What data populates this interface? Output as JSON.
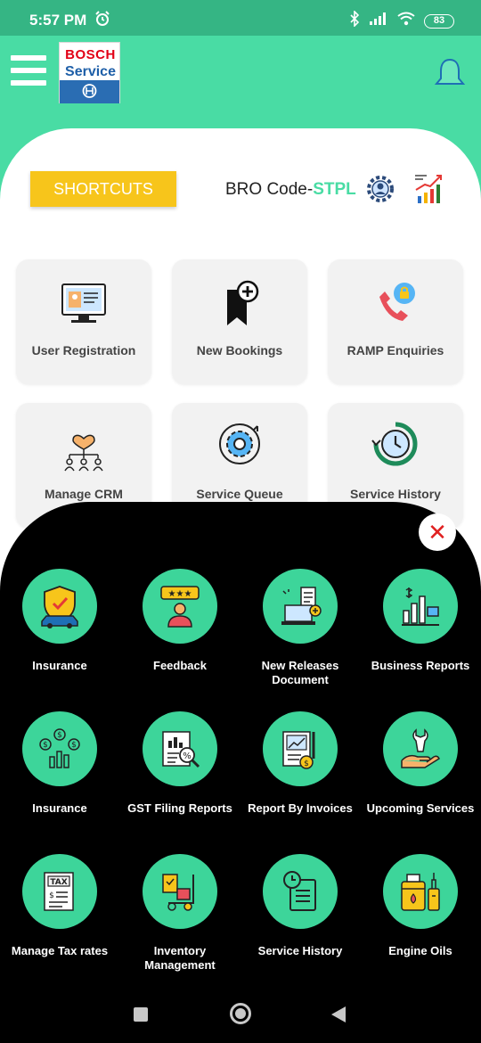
{
  "status_bar": {
    "time": "5:57 PM",
    "battery": "83",
    "icons": [
      "alarm-icon",
      "bluetooth-icon",
      "signal-icon",
      "wifi-icon",
      "battery-icon"
    ]
  },
  "header": {
    "logo_brand": "BOSCH",
    "logo_sub": "Service",
    "menu_icon": "hamburger-icon",
    "bell_icon": "bell-icon"
  },
  "shortcuts": {
    "button_label": "SHORTCUTS",
    "bro_code_label": "BRO Code-",
    "bro_code_value": "STPL"
  },
  "tiles": [
    {
      "label": "User Registration",
      "icon": "user-registration-icon"
    },
    {
      "label": "New Bookings",
      "icon": "bookmark-add-icon"
    },
    {
      "label": "RAMP Enquiries",
      "icon": "phone-enquiry-icon"
    },
    {
      "label": "Manage CRM",
      "icon": "crm-icon"
    },
    {
      "label": "Service Queue",
      "icon": "gear-icon"
    },
    {
      "label": "Service History",
      "icon": "history-clock-icon"
    }
  ],
  "menu": {
    "items": [
      {
        "label": "Insurance",
        "icon": "shield-car-icon"
      },
      {
        "label": "Feedback",
        "icon": "rating-feedback-icon"
      },
      {
        "label": "New Releases Document",
        "icon": "document-release-icon"
      },
      {
        "label": "Business Reports",
        "icon": "business-chart-icon"
      },
      {
        "label": "Insurance",
        "icon": "money-chart-icon"
      },
      {
        "label": "GST Filing Reports",
        "icon": "gst-report-icon"
      },
      {
        "label": "Report By Invoices",
        "icon": "invoice-report-icon"
      },
      {
        "label": "Upcoming Services",
        "icon": "wrench-hand-icon"
      },
      {
        "label": "Manage Tax rates",
        "icon": "tax-document-icon"
      },
      {
        "label": "Inventory Management",
        "icon": "inventory-trolley-icon"
      },
      {
        "label": "Service History",
        "icon": "clock-document-icon"
      },
      {
        "label": "Engine Oils",
        "icon": "oil-can-icon"
      }
    ],
    "close_icon": "close-icon"
  },
  "colors": {
    "header_green": "#49dca4",
    "status_green": "#35b584",
    "circle_green": "#3dd59a",
    "shortcut_yellow": "#f7c51b"
  }
}
